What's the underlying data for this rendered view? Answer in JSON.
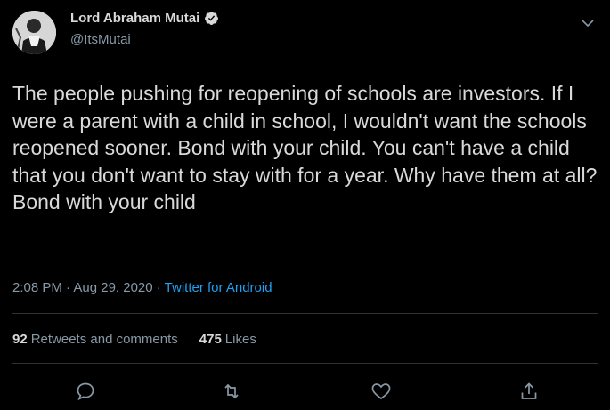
{
  "user": {
    "name": "Lord Abraham Mutai",
    "handle": "@ItsMutai",
    "verified": true
  },
  "tweet": {
    "text": "The people pushing for reopening of schools are investors. If I were a parent with a child in school, I wouldn't want the schools reopened sooner. Bond with your child. You can't have a child that you don't want to stay with for a year. Why have them at all? Bond with your child",
    "time": "2:08 PM · Aug 29, 2020 · ",
    "source": "Twitter for Android"
  },
  "stats": {
    "retweets_count": "92",
    "retweets_label": "Retweets and comments",
    "likes_count": "475",
    "likes_label": "Likes"
  },
  "icons": {
    "reply": "comment-icon",
    "retweet": "retweet-icon",
    "like": "heart-icon",
    "share": "share-icon",
    "menu": "chevron-down-icon",
    "verified": "verified-badge-icon"
  },
  "colors": {
    "background": "#000000",
    "text": "#d9d9d9",
    "muted": "#8899a6",
    "accent": "#1da1f2",
    "divider": "#2f3336"
  }
}
